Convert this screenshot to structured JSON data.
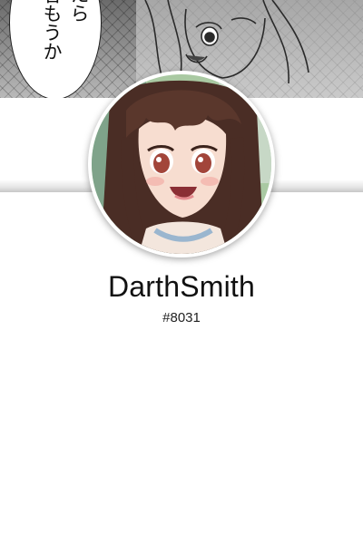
{
  "banner": {
    "bubble_text": [
      "帰ったら",
      "お酒呑もうか"
    ],
    "icon": "manga-banner-image"
  },
  "avatar": {
    "icon": "anime-girl-avatar"
  },
  "profile": {
    "username": "DarthSmith",
    "discriminator": "#8031"
  },
  "colors": {
    "background": "#ffffff",
    "text": "#111111",
    "avatar_ring": "#ffffff"
  }
}
